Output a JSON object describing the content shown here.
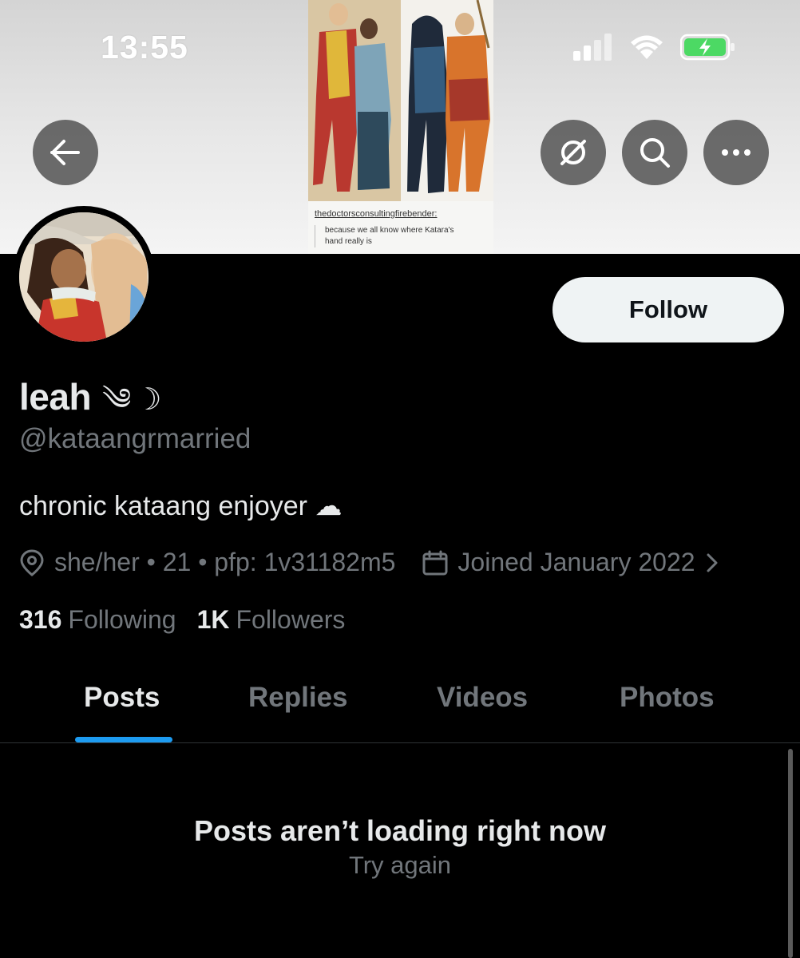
{
  "status_bar": {
    "time": "13:55",
    "icons": [
      "cellular-signal-icon",
      "wifi-icon",
      "battery-charging-icon"
    ],
    "battery_color": "#4cd964"
  },
  "header": {
    "buttons": [
      "back-arrow-icon",
      "grok-icon",
      "search-icon",
      "more-icon"
    ]
  },
  "banner": {
    "caption_user": "thedoctorsconsultingfirebender:",
    "caption_quote": "because we all know where Katara's\nhand really is"
  },
  "profile": {
    "display_name": "leah",
    "name_emoji": "༄☽",
    "handle": "@kataangrmarried",
    "bio": "chronic kataang enjoyer ☁︎",
    "location": "she/her • 21 • pfp: 1v31182m5",
    "joined": "Joined January 2022",
    "following_count": "316",
    "following_label": "Following",
    "followers_count": "1K",
    "followers_label": "Followers",
    "follow_button": "Follow"
  },
  "tabs": [
    {
      "label": "Posts",
      "active": true
    },
    {
      "label": "Replies",
      "active": false
    },
    {
      "label": "Videos",
      "active": false
    },
    {
      "label": "Photos",
      "active": false
    }
  ],
  "feed": {
    "empty_title": "Posts aren’t loading right now",
    "retry_label": "Try again"
  },
  "colors": {
    "background": "#000000",
    "primary_text": "#e7e9ea",
    "secondary_text": "#71767b",
    "accent": "#1d9bf0",
    "follow_button_bg": "#eff3f4"
  }
}
